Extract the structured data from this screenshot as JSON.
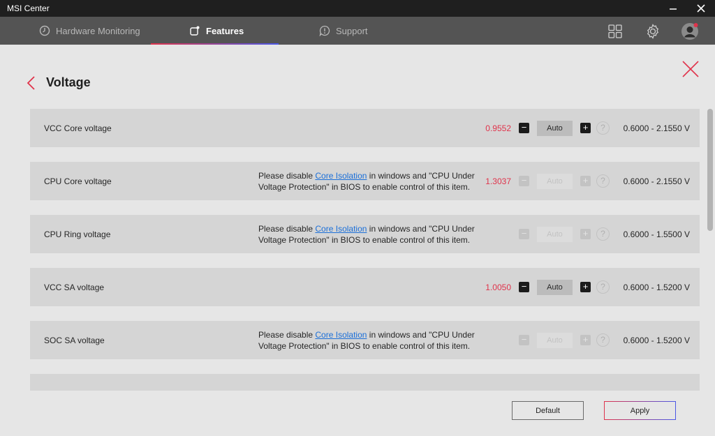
{
  "window": {
    "title": "MSI Center"
  },
  "nav": {
    "tabs": [
      {
        "label": "Hardware Monitoring"
      },
      {
        "label": "Features"
      },
      {
        "label": "Support"
      }
    ]
  },
  "page": {
    "title": "Voltage"
  },
  "note": {
    "before": "Please disable ",
    "link": "Core Isolation",
    "after": " in windows and \"CPU Under Voltage Protection\" in BIOS to enable control of this item."
  },
  "rows": [
    {
      "name": "VCC Core voltage",
      "value": "0.9552",
      "auto": "Auto",
      "range": "0.6000 - 2.1550 V"
    },
    {
      "name": "CPU Core voltage",
      "value": "1.3037",
      "auto": "Auto",
      "range": "0.6000 - 2.1550 V"
    },
    {
      "name": "CPU Ring voltage",
      "value": "",
      "auto": "Auto",
      "range": "0.6000 - 1.5500 V"
    },
    {
      "name": "VCC SA voltage",
      "value": "1.0050",
      "auto": "Auto",
      "range": "0.6000 - 1.5200 V"
    },
    {
      "name": "SOC SA voltage",
      "value": "",
      "auto": "Auto",
      "range": "0.6000 - 1.5200 V"
    }
  ],
  "footer": {
    "default_label": "Default",
    "apply_label": "Apply"
  },
  "colors": {
    "accent_red": "#e0334b",
    "accent_blue": "#4a58e6",
    "link": "#1b6fd8"
  },
  "icons": [
    "hardware-monitoring-icon",
    "features-icon",
    "support-icon",
    "grid-icon",
    "gear-icon",
    "avatar",
    "back-icon",
    "close-icon",
    "help-icon"
  ]
}
